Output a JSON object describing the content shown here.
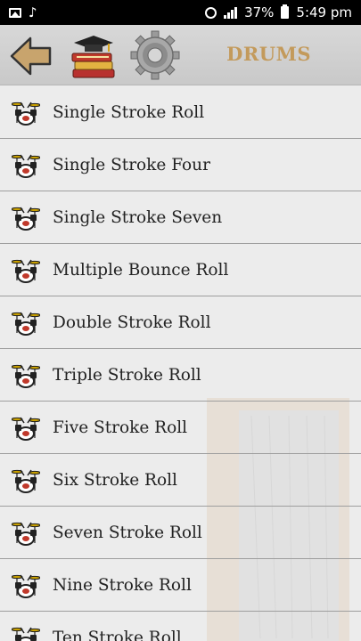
{
  "status_bar": {
    "battery": "37%",
    "time": "5:49 pm"
  },
  "header": {
    "title": "DRUMS",
    "icons": [
      "back-arrow-icon",
      "books-graduation-icon",
      "gear-icon"
    ]
  },
  "list": {
    "items": [
      {
        "label": "Single Stroke Roll"
      },
      {
        "label": "Single Stroke Four"
      },
      {
        "label": "Single Stroke Seven"
      },
      {
        "label": "Multiple Bounce Roll"
      },
      {
        "label": "Double Stroke Roll"
      },
      {
        "label": "Triple Stroke Roll"
      },
      {
        "label": "Five Stroke Roll"
      },
      {
        "label": "Six Stroke Roll"
      },
      {
        "label": "Seven Stroke Roll"
      },
      {
        "label": "Nine Stroke Roll"
      },
      {
        "label": "Ten Stroke Roll"
      }
    ],
    "item_icon": "drum-kit-icon"
  },
  "colors": {
    "header_bg": "#d0d0d0",
    "title": "#c39a5b",
    "back_arrow": "#c8a46d",
    "list_bg": "#ececec",
    "divider": "#9e9e9e"
  }
}
